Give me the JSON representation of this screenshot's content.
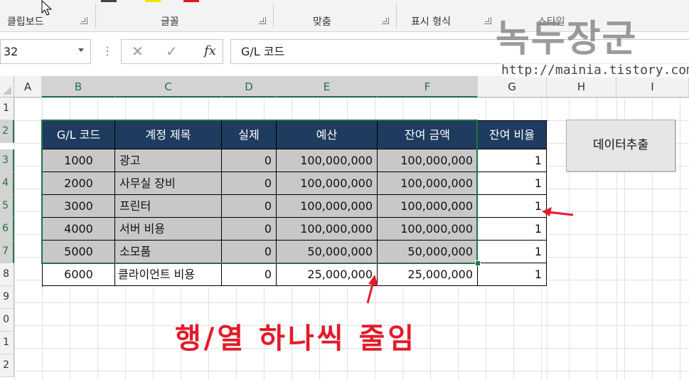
{
  "ribbon": {
    "groups": [
      "클립보드",
      "글꼴",
      "맞춤",
      "표시 형식",
      "스타일"
    ]
  },
  "formula_bar": {
    "name_box": "32",
    "fx": "fx",
    "content": "G/L 코드"
  },
  "columns": [
    "A",
    "B",
    "C",
    "D",
    "E",
    "F",
    "G",
    "H",
    "I"
  ],
  "rows": [
    "1",
    "2",
    "3",
    "4",
    "5",
    "6",
    "7",
    "8",
    "9",
    "0",
    "1",
    "2"
  ],
  "table": {
    "headers": [
      "G/L 코드",
      "계정 제목",
      "실제",
      "예산",
      "잔여 금액",
      "잔여 비율"
    ],
    "rows": [
      [
        "1000",
        "광고",
        "0",
        "100,000,000",
        "100,000,000",
        "1"
      ],
      [
        "2000",
        "사무실 장비",
        "0",
        "100,000,000",
        "100,000,000",
        "1"
      ],
      [
        "3000",
        "프린터",
        "0",
        "100,000,000",
        "100,000,000",
        "1"
      ],
      [
        "4000",
        "서버 비용",
        "0",
        "100,000,000",
        "100,000,000",
        "1"
      ],
      [
        "5000",
        "소모품",
        "0",
        "50,000,000",
        "50,000,000",
        "1"
      ],
      [
        "6000",
        "클라이언트 비용",
        "0",
        "25,000,000",
        "25,000,000",
        "1"
      ]
    ]
  },
  "extract_button": "데이터추출",
  "annotation": "행/열 하나씩 줄임",
  "watermark": {
    "title": "녹두장군",
    "url": "http://mainia.tistory.com"
  },
  "colors": {
    "header_fill": "#1f3b5f",
    "selected_fill": "#c8c8c8",
    "selection_border": "#217346",
    "annotation_red": "#e21b2a"
  },
  "icons": [
    "cancel-icon",
    "enter-icon",
    "fx-icon",
    "dropdown-arrow-icon",
    "mouse-cursor-icon",
    "red-arrow-icon",
    "dialog-launcher-icon"
  ]
}
